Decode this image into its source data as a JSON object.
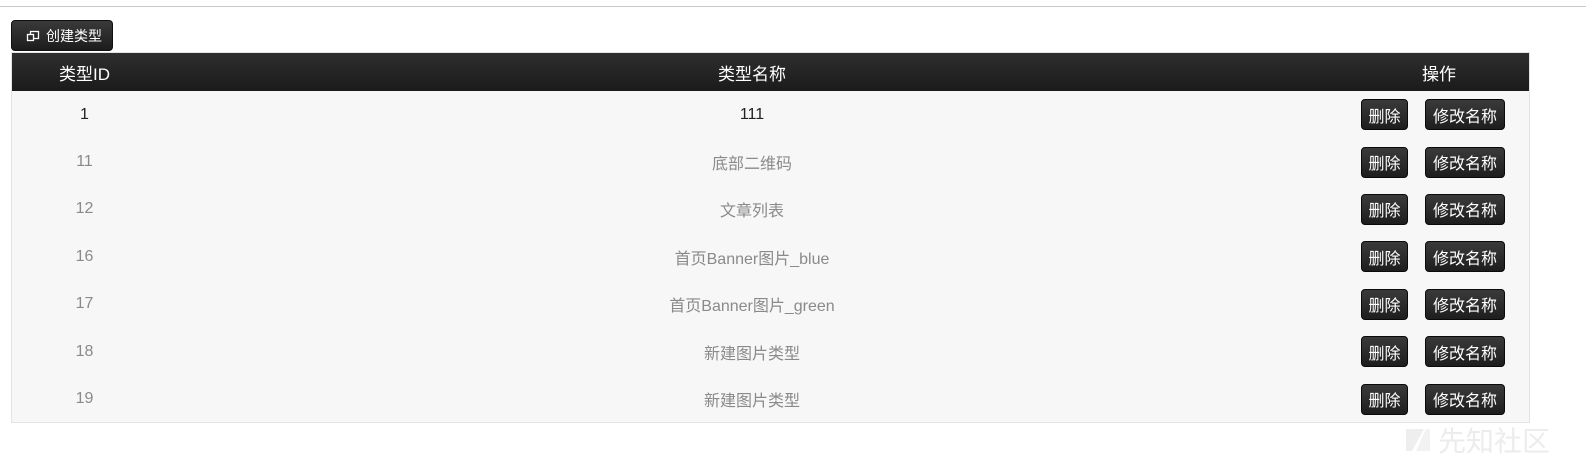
{
  "toolbar": {
    "create_label": "创建类型"
  },
  "table": {
    "headers": {
      "id": "类型ID",
      "name": "类型名称",
      "ops": "操作"
    },
    "delete_label": "删除",
    "rename_label": "修改名称",
    "rows": [
      {
        "id": "1",
        "name": "111"
      },
      {
        "id": "11",
        "name": "底部二维码"
      },
      {
        "id": "12",
        "name": "文章列表"
      },
      {
        "id": "16",
        "name": "首页Banner图片_blue"
      },
      {
        "id": "17",
        "name": "首页Banner图片_green"
      },
      {
        "id": "18",
        "name": "新建图片类型"
      },
      {
        "id": "19",
        "name": "新建图片类型"
      }
    ]
  },
  "watermark": {
    "text": "先知社区"
  },
  "colors": {
    "header_bg": "#222222",
    "button_bg": "#2a2a2a",
    "row_bg": "#f7f7f7"
  }
}
